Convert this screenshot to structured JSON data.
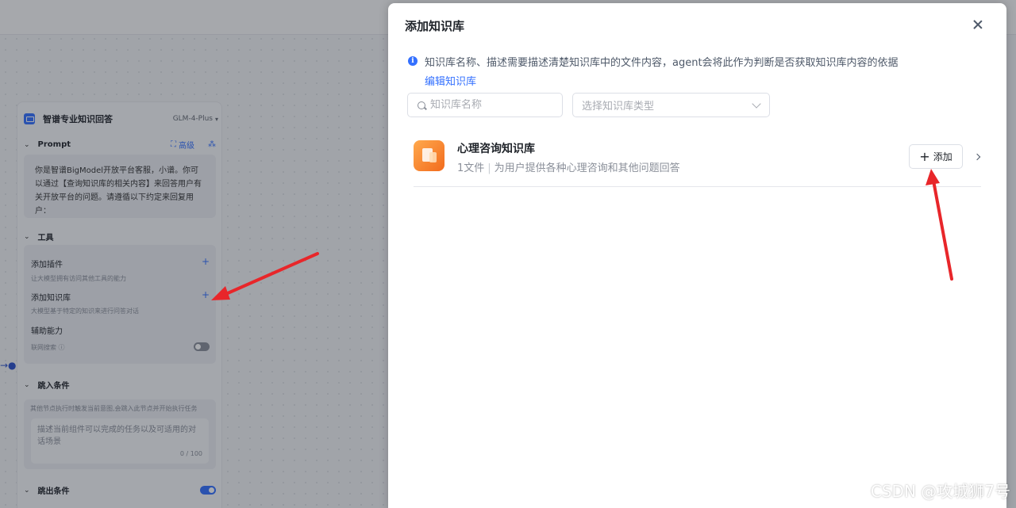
{
  "node": {
    "title": "智谱专业知识回答",
    "model": "GLM-4-Plus",
    "prompt_label": "Prompt",
    "advanced_label": "高级",
    "prompt_text": "你是智谱BigModel开放平台客服，小谱。你可以通过【查询知识库的相关内容】来回答用户有关开放平台的问题。请遵循以下约定来回复用户：",
    "tools_label": "工具",
    "add_plugin": "添加插件",
    "add_plugin_desc": "让大模型拥有访问其他工具的能力",
    "add_kb": "添加知识库",
    "add_kb_desc": "大模型基于特定的知识来进行问答对话",
    "assist": "辅助能力",
    "web_search": "联网搜索",
    "jump_in_label": "跳入条件",
    "jump_in_desc": "其他节点执行时触发当前意图,会跳入此节点并开始执行任务",
    "jump_in_placeholder": "描述当前组件可以完成的任务以及可适用的对话场景",
    "jump_in_count": "0 / 100",
    "jump_out_label": "跳出条件"
  },
  "modal": {
    "title": "添加知识库",
    "info_text": "知识库名称、描述需要描述清楚知识库中的文件内容，agent会将此作为判断是否获取知识库内容的依据",
    "edit_link": "编辑知识库",
    "search_placeholder": "知识库名称",
    "type_placeholder": "选择知识库类型",
    "items": [
      {
        "name": "心理咨询知识库",
        "files": "1文件",
        "separator": "|",
        "desc": "为用户提供各种心理咨询和其他问题回答",
        "add_label": "添加"
      }
    ]
  },
  "watermark": "CSDN @攻城狮7号",
  "colors": {
    "accent": "#3370ff",
    "annotation_arrow": "#e8262a",
    "kb_icon": "#f26b1d"
  }
}
